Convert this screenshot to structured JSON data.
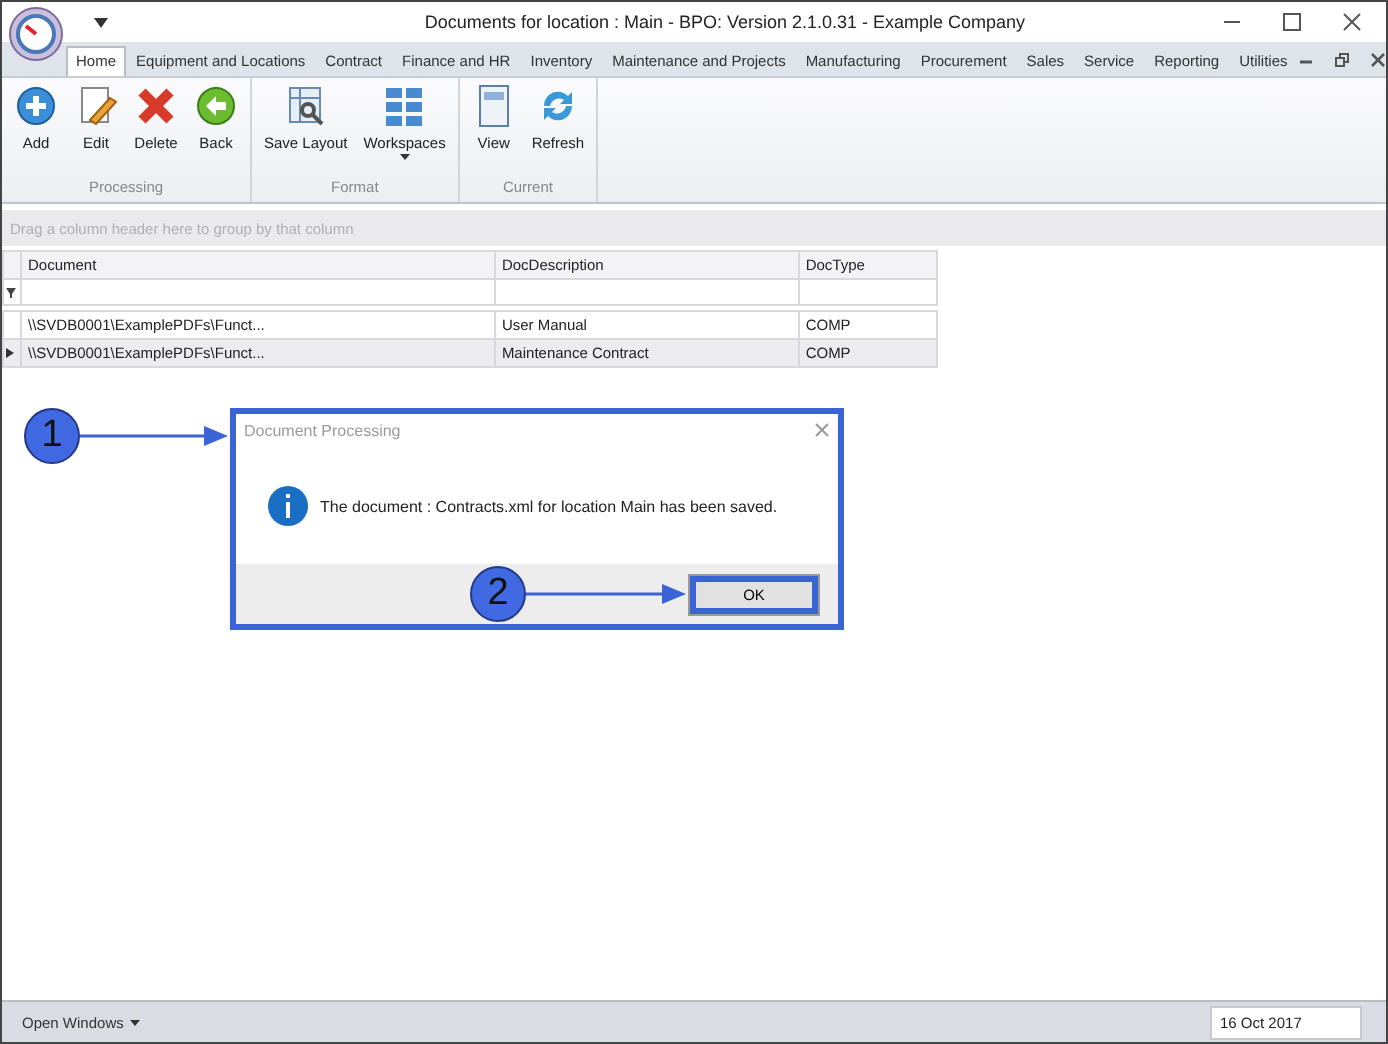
{
  "window": {
    "title": "Documents for location : Main - BPO: Version 2.1.0.31 - Example Company"
  },
  "tabs": [
    {
      "label": "Home",
      "selected": true
    },
    {
      "label": "Equipment and Locations",
      "selected": false
    },
    {
      "label": "Contract",
      "selected": false
    },
    {
      "label": "Finance and HR",
      "selected": false
    },
    {
      "label": "Inventory",
      "selected": false
    },
    {
      "label": "Maintenance and Projects",
      "selected": false
    },
    {
      "label": "Manufacturing",
      "selected": false
    },
    {
      "label": "Procurement",
      "selected": false
    },
    {
      "label": "Sales",
      "selected": false
    },
    {
      "label": "Service",
      "selected": false
    },
    {
      "label": "Reporting",
      "selected": false
    },
    {
      "label": "Utilities",
      "selected": false
    }
  ],
  "ribbon_groups": [
    {
      "label": "Processing",
      "buttons": [
        {
          "label": "Add",
          "dropdown": false
        },
        {
          "label": "Edit",
          "dropdown": false
        },
        {
          "label": "Delete",
          "dropdown": false
        },
        {
          "label": "Back",
          "dropdown": false
        }
      ]
    },
    {
      "label": "Format",
      "buttons": [
        {
          "label": "Save Layout",
          "dropdown": false
        },
        {
          "label": "Workspaces",
          "dropdown": true
        }
      ]
    },
    {
      "label": "Current",
      "buttons": [
        {
          "label": "View",
          "dropdown": false
        },
        {
          "label": "Refresh",
          "dropdown": false
        }
      ]
    }
  ],
  "grid": {
    "group_panel_hint": "Drag a column header here to group by that column",
    "columns": [
      "Document",
      "DocDescription",
      "DocType"
    ],
    "rows": [
      {
        "cells": [
          "\\\\SVDB0001\\ExamplePDFs\\Funct...",
          "User Manual",
          "COMP"
        ],
        "selected": false
      },
      {
        "cells": [
          "\\\\SVDB0001\\ExamplePDFs\\Funct...",
          "Maintenance Contract",
          "COMP"
        ],
        "selected": true
      }
    ]
  },
  "dialog": {
    "title": "Document Processing",
    "message": "The document : Contracts.xml for location Main has been saved.",
    "button": "OK"
  },
  "callouts": [
    "1",
    "2"
  ],
  "status_bar": {
    "open_windows": "Open Windows",
    "date": "16 Oct 2017"
  }
}
